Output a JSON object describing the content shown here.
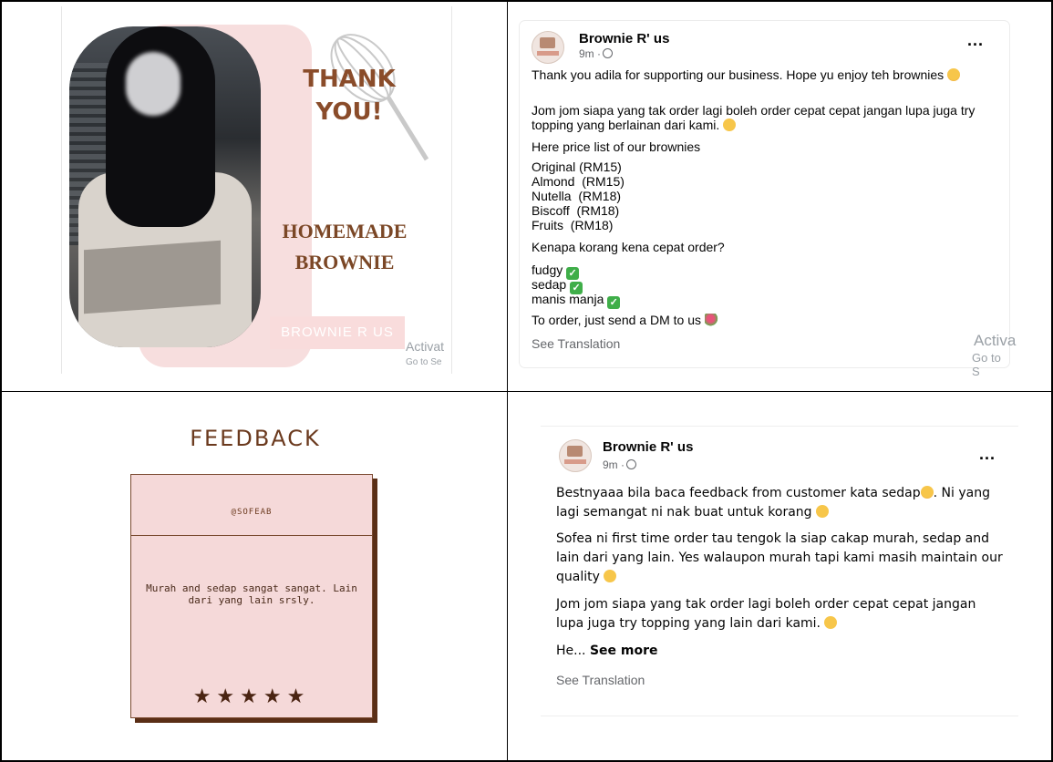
{
  "thank_you_card": {
    "title": "THANK YOU!",
    "subtitle": "HOMEMADE BROWNIE",
    "button_label": "BROWNIE R US",
    "watermark_line1": "Activat",
    "watermark_line2": "Go to Se"
  },
  "post_top": {
    "page_name": "Brownie R' us",
    "meta": "9m ·",
    "more_menu": "...",
    "para1": "Thank you adila for supporting our business. Hope yu enjoy teh brownies",
    "para2": "Jom jom siapa yang tak order lagi boleh order cepat cepat jangan lupa juga try topping yang berlainan dari kami.",
    "para3": "Here price list of our brownies",
    "prices": [
      "Original (RM15)",
      "Almond  (RM15)",
      "Nutella  (RM18)",
      "Biscoff  (RM18)",
      "Fruits  (RM18)"
    ],
    "question": "Kenapa korang kena cepat order?",
    "reasons": [
      "fudgy",
      "sedap",
      "manis manja"
    ],
    "cta": "To order, just send a DM to us",
    "see_translation": "See Translation",
    "watermark_line1": "Activa",
    "watermark_line2": "Go to S"
  },
  "feedback_card": {
    "title": "FEEDBACK",
    "handle": "@SOFEAB",
    "review": "Murah and sedap sangat sangat. Lain dari yang lain srsly.",
    "stars": "★★★★★",
    "rating": 5
  },
  "post_bottom": {
    "page_name": "Brownie R' us",
    "meta": "9m ·",
    "more_menu": "...",
    "para1": "Bestnyaaa bila baca feedback from customer kata sedap",
    "para1b": ". Ni yang lagi semangat ni nak buat untuk korang",
    "para2": "Sofea ni first time order tau tengok la siap cakap murah, sedap and lain dari yang lain. Yes walaupon murah tapi kami masih maintain our quality",
    "para3": "Jom jom siapa yang tak order lagi boleh order cepat cepat jangan lupa juga try topping yang lain dari kami.",
    "truncated": "He...",
    "see_more": "See more",
    "see_translation": "See Translation"
  }
}
